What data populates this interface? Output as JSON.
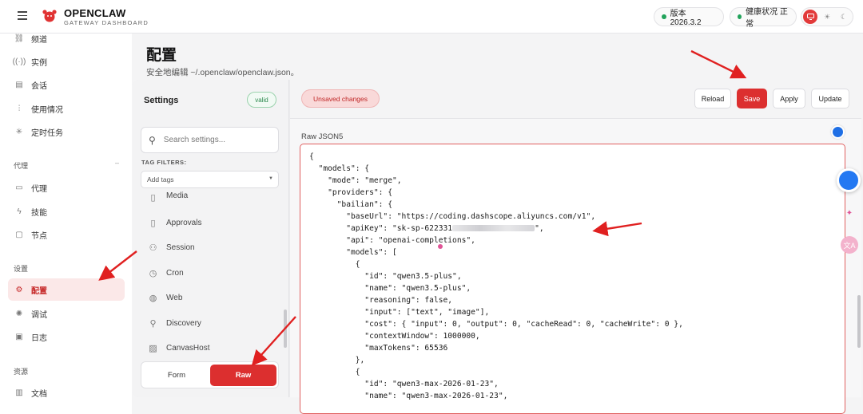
{
  "app": {
    "name": "OPENCLAW",
    "subtitle": "GATEWAY DASHBOARD",
    "version_label": "版本 2026.3.2",
    "health_label": "健康状况 正常"
  },
  "sidebar": {
    "top_items": [
      {
        "label": "频道",
        "icon": "link-icon"
      },
      {
        "label": "实例",
        "icon": "radio-icon"
      },
      {
        "label": "会话",
        "icon": "file-icon"
      },
      {
        "label": "使用情况",
        "icon": "bar-chart-icon"
      },
      {
        "label": "定时任务",
        "icon": "loader-icon"
      }
    ],
    "section_agent": "代理",
    "agent_items": [
      {
        "label": "代理",
        "icon": "folder-icon"
      },
      {
        "label": "技能",
        "icon": "zap-icon"
      },
      {
        "label": "节点",
        "icon": "monitor-icon"
      }
    ],
    "section_settings": "设置",
    "settings_items": [
      {
        "label": "配置",
        "icon": "gear-icon",
        "active": true
      },
      {
        "label": "调试",
        "icon": "bug-icon"
      },
      {
        "label": "日志",
        "icon": "scroll-icon"
      }
    ],
    "section_resources": "资源",
    "resource_items": [
      {
        "label": "文档",
        "icon": "book-icon"
      }
    ]
  },
  "page": {
    "title": "配置",
    "subtitle": "安全地编辑 ~/.openclaw/openclaw.json。"
  },
  "settings_panel": {
    "title": "Settings",
    "status": "valid",
    "search_placeholder": "Search settings...",
    "tag_filters_label": "TAG FILTERS:",
    "tag_placeholder": "Add tags",
    "sections": [
      {
        "label": "Media",
        "icon": "file-icon"
      },
      {
        "label": "Approvals",
        "icon": "file-icon"
      },
      {
        "label": "Session",
        "icon": "users-icon"
      },
      {
        "label": "Cron",
        "icon": "clock-icon"
      },
      {
        "label": "Web",
        "icon": "globe-icon"
      },
      {
        "label": "Discovery",
        "icon": "search-icon"
      },
      {
        "label": "CanvasHost",
        "icon": "image-icon"
      }
    ],
    "mode_form": "Form",
    "mode_raw": "Raw"
  },
  "editor": {
    "unsaved_label": "Unsaved changes",
    "actions": {
      "reload": "Reload",
      "save": "Save",
      "apply": "Apply",
      "update": "Update"
    },
    "raw_label": "Raw JSON5",
    "lines": [
      "{",
      "  \"models\": {",
      "    \"mode\": \"merge\",",
      "    \"providers\": {",
      "      \"bailian\": {",
      "        \"baseUrl\": \"https://coding.dashscope.aliyuncs.com/v1\",",
      "        \"apiKey\": \"sk-sp-622331",
      "        \"api\": \"openai-completions\",",
      "        \"models\": [",
      "          {",
      "            \"id\": \"qwen3.5-plus\",",
      "            \"name\": \"qwen3.5-plus\",",
      "            \"reasoning\": false,",
      "            \"input\": [\"text\", \"image\"],",
      "            \"cost\": { \"input\": 0, \"output\": 0, \"cacheRead\": 0, \"cacheWrite\": 0 },",
      "            \"contextWindow\": 1000000,",
      "            \"maxTokens\": 65536",
      "          },",
      "          {",
      "            \"id\": \"qwen3-max-2026-01-23\",",
      "            \"name\": \"qwen3-max-2026-01-23\","
    ],
    "api_key_suffix": "\","
  },
  "colors": {
    "accent": "#dc2f2f",
    "active_bg": "#fbe8e8",
    "valid": "#2c8a4e",
    "annotation_arrow": "#e02020"
  }
}
